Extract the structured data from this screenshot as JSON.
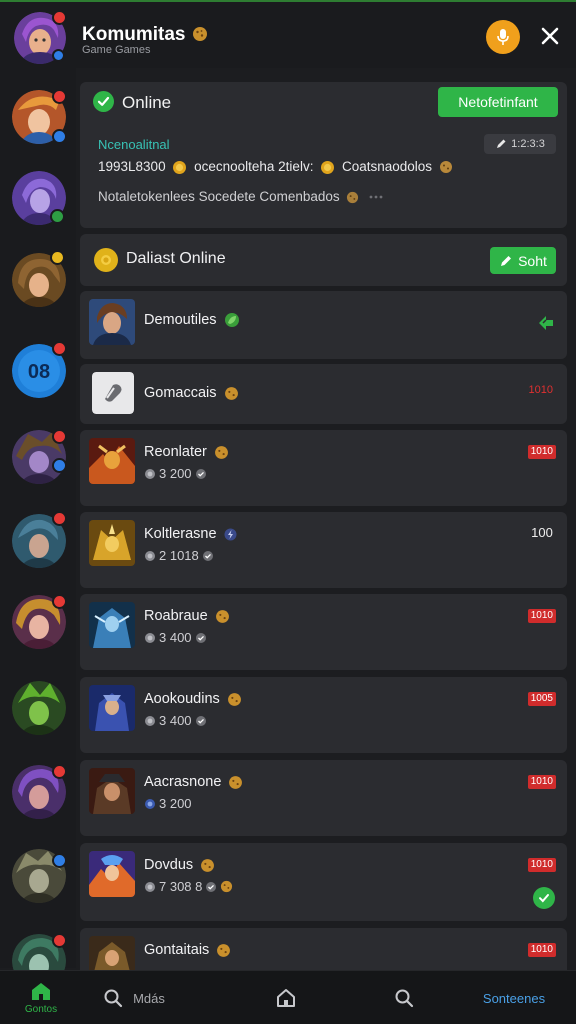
{
  "header": {
    "title": "Komumitas",
    "subtitle": "Game Games"
  },
  "status_card": {
    "label": "Online",
    "button": "Netofetinfant",
    "teal_text": "Ncenoalitnal",
    "pill_text": "1:2:3:3",
    "line1_a": "1993L8300",
    "line1_b": "ocecnoolteha 2tielv:",
    "line1_c": "Coatsnaodolos",
    "line2": "Notaletokenlees Socedete Comenbados"
  },
  "section": {
    "label": "Daliast Online",
    "button": "Soht"
  },
  "items": [
    {
      "name": "Demoutiles"
    },
    {
      "name": "Gomaccais",
      "badge": "1010"
    },
    {
      "name": "Reonlater",
      "stat": "3 200",
      "badge": "1010"
    },
    {
      "name": "Koltlerasne",
      "stat": "2 1018",
      "badge": "100"
    },
    {
      "name": "Roabraue",
      "stat": "3 400",
      "badge": "1010"
    },
    {
      "name": "Aookoudins",
      "stat": "3 400",
      "badge": "1005"
    },
    {
      "name": "Aacrasnone",
      "stat": "3 200",
      "badge": "1010"
    },
    {
      "name": "Dovdus",
      "stat": "7 308 8",
      "badge": "1010"
    },
    {
      "name": "Gontaitais",
      "badge": "1010"
    }
  ],
  "bottom_nav": {
    "home_label": "Gontos",
    "search_label": "Mdás",
    "last_label": "Sonteenes"
  },
  "colors": {
    "accent_green": "#2fb548",
    "badge_red": "#d02c2c",
    "mic_orange": "#f0a01c",
    "teal_text": "#38c2b5",
    "background": "#1c1d20",
    "card": "#2b2c30"
  },
  "icons": {
    "header": [
      "microphone-icon",
      "close-icon"
    ],
    "status": [
      "check-circle-icon",
      "pen-icon",
      "coin-icon"
    ],
    "nav": [
      "home-icon",
      "search-icon",
      "house-icon",
      "search-icon"
    ]
  }
}
